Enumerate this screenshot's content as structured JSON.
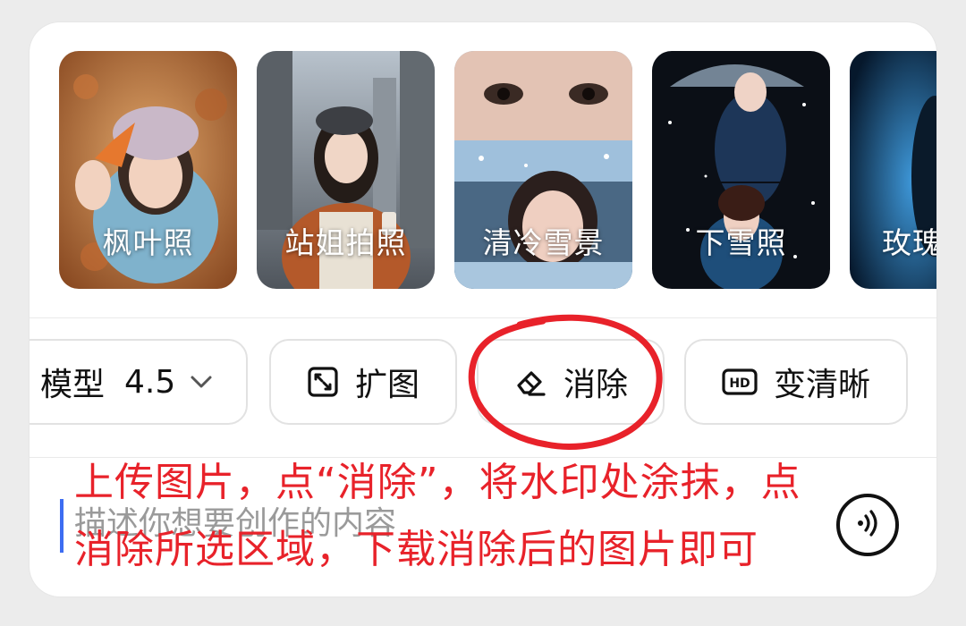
{
  "styles": [
    {
      "label": "枫叶照"
    },
    {
      "label": "站姐拍照"
    },
    {
      "label": "清冷雪景"
    },
    {
      "label": "下雪照"
    },
    {
      "label": "玫瑰"
    }
  ],
  "toolbar": {
    "model_label": "模型",
    "model_version": "4.5",
    "model_icon": "chevron-down-icon",
    "expand_label": "扩图",
    "expand_icon": "expand-icon",
    "erase_label": "消除",
    "erase_icon": "eraser-icon",
    "hd_label": "变清晰",
    "hd_icon": "hd-icon"
  },
  "prompt": {
    "placeholder": "描述你想要创作的内容",
    "value": "",
    "voice_icon": "voice-icon"
  },
  "annotation": {
    "line1": "上传图片，点“消除”，将水印处涂抹，点",
    "line2": "消除所选区域，下载消除后的图片即可",
    "color": "#e8222a"
  }
}
